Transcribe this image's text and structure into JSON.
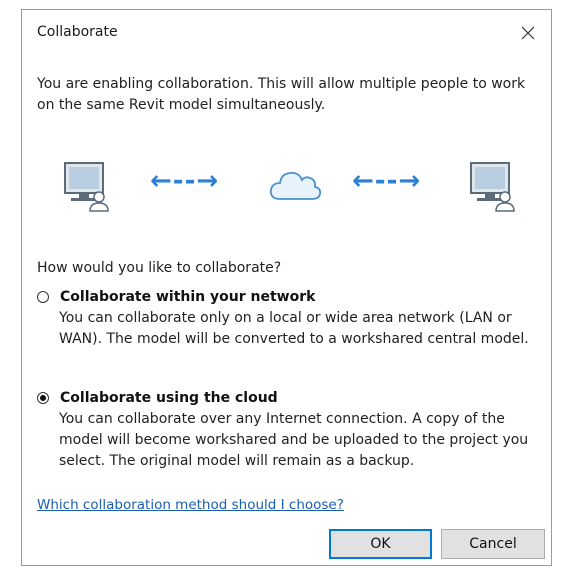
{
  "window": {
    "title": "Collaborate",
    "close_icon": "close-icon"
  },
  "intro_text": "You are enabling collaboration. This will allow multiple people to work on the same Revit model simultaneously.",
  "diagram": {
    "left_icon": "computer-user-icon",
    "left_arrow": "←--→",
    "center_icon": "cloud-icon",
    "right_arrow": "←--→",
    "right_icon": "computer-user-icon",
    "accent_color": "#2b7fd6"
  },
  "question": "How would you like to collaborate?",
  "options": [
    {
      "label": "Collaborate within your network",
      "description": "You can collaborate only on a local or wide area network (LAN or WAN). The model will be converted to a workshared central model.",
      "selected": false
    },
    {
      "label": "Collaborate using the cloud",
      "description": "You can collaborate over any Internet connection. A copy of the model will become workshared and be uploaded to the project you select. The original model will remain as a backup.",
      "selected": true
    }
  ],
  "help_link": "Which collaboration method should I choose?",
  "buttons": {
    "ok": "OK",
    "cancel": "Cancel"
  }
}
